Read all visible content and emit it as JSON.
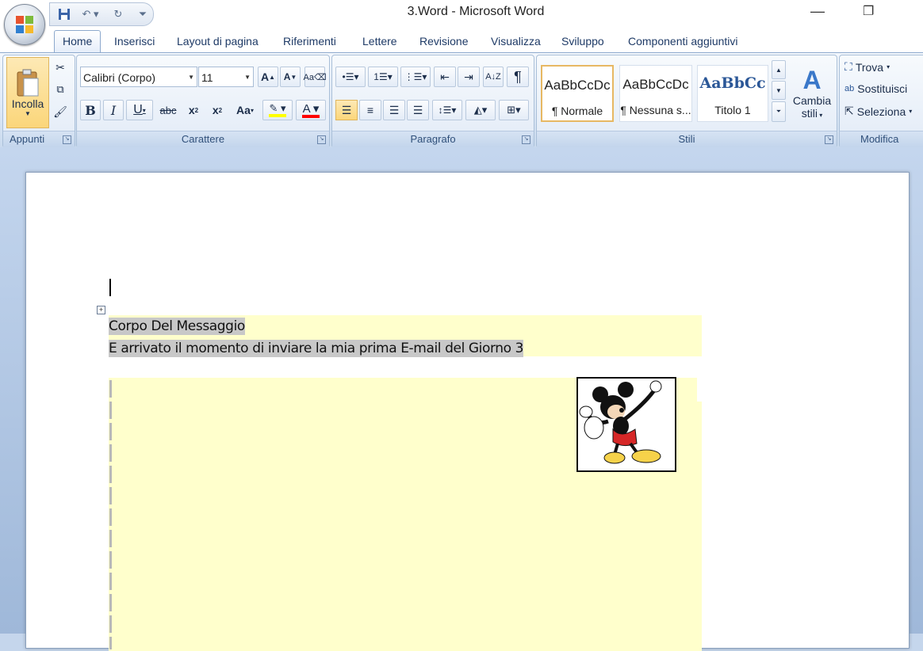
{
  "window": {
    "title": "3.Word - Microsoft Word"
  },
  "tabs": [
    "Home",
    "Inserisci",
    "Layout di pagina",
    "Riferimenti",
    "Lettere",
    "Revisione",
    "Visualizza",
    "Sviluppo",
    "Componenti aggiuntivi"
  ],
  "ribbon": {
    "clipboard": {
      "paste_label": "Incolla",
      "group_label": "Appunti"
    },
    "font": {
      "font_name": "Calibri (Corpo)",
      "font_size": "11",
      "group_label": "Carattere",
      "highlight_color": "#ffff00",
      "font_color": "#ff0000"
    },
    "paragraph": {
      "group_label": "Paragrafo"
    },
    "styles": {
      "group_label": "Stili",
      "items": [
        {
          "sample": "AaBbCcDc",
          "name": "¶ Normale"
        },
        {
          "sample": "AaBbCcDc",
          "name": "¶ Nessuna s..."
        },
        {
          "sample": "AaBbCc",
          "name": "Titolo 1"
        }
      ],
      "change_line1": "Cambia",
      "change_line2": "stili"
    },
    "editing": {
      "group_label": "Modifica",
      "find": "Trova",
      "replace": "Sostituisci",
      "select": "Seleziona"
    }
  },
  "document": {
    "line1": "Corpo Del Messaggio",
    "line2": "E arrivato il momento di inviare la mia prima E-mail del Giorno 3",
    "field_shading": "#ffffcc"
  }
}
